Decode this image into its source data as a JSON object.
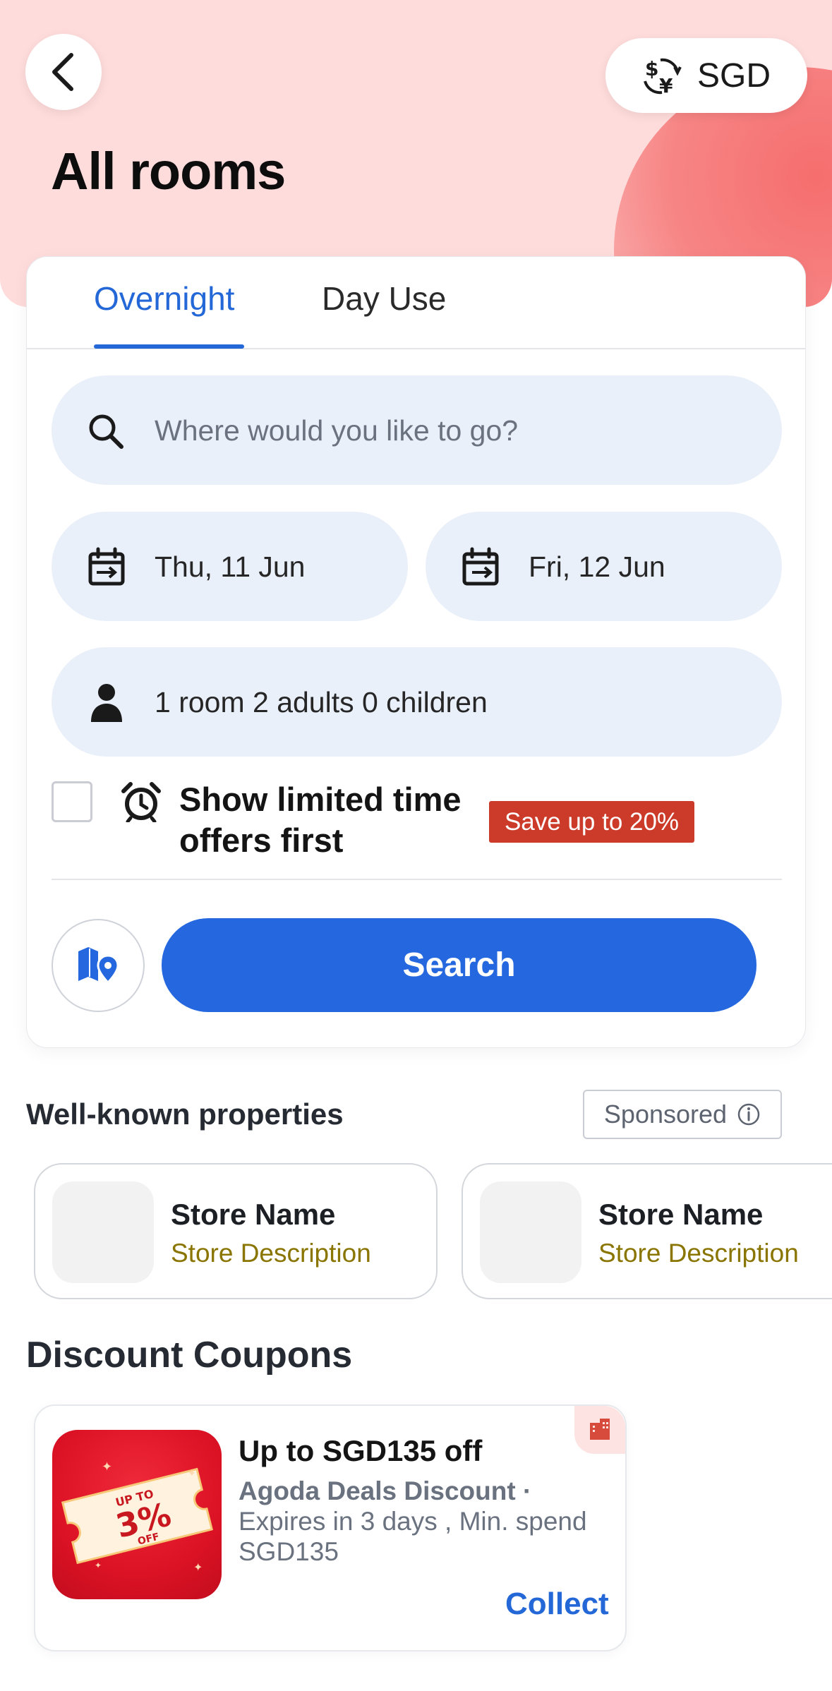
{
  "header": {
    "title": "All rooms",
    "currency_label": "SGD",
    "back_icon": "chevron-left-icon",
    "currency_icon": "currency-exchange-icon"
  },
  "tabs": [
    {
      "label": "Overnight",
      "active": true
    },
    {
      "label": "Day Use",
      "active": false
    }
  ],
  "search": {
    "placeholder": "Where would you like to go?",
    "checkin": "Thu, 11 Jun",
    "checkout": "Fri, 12 Jun",
    "occupancy": "1 room 2 adults 0 children",
    "limited_offers_label": "Show limited time offers first",
    "limited_offers_checked": false,
    "save_badge": "Save up to 20%",
    "search_button": "Search"
  },
  "well_known": {
    "title": "Well-known properties",
    "sponsored_label": "Sponsored",
    "stores": [
      {
        "name": "Store Name",
        "description": "Store Description"
      },
      {
        "name": "Store Name",
        "description": "Store Description"
      }
    ]
  },
  "coupons": {
    "title": "Discount Coupons",
    "items": [
      {
        "title": "Up to SGD135 off",
        "provider": "Agoda Deals Discount ·",
        "meta": "Expires in 3 days , Min. spend SGD135",
        "badge_top": "UP TO",
        "badge_value": "3%",
        "badge_bottom": "OFF",
        "action": "Collect"
      }
    ]
  },
  "colors": {
    "accent": "#2467df",
    "hero_bg": "#ffdcdc",
    "badge_red": "#cc3a2a",
    "store_desc": "#8a7500"
  }
}
